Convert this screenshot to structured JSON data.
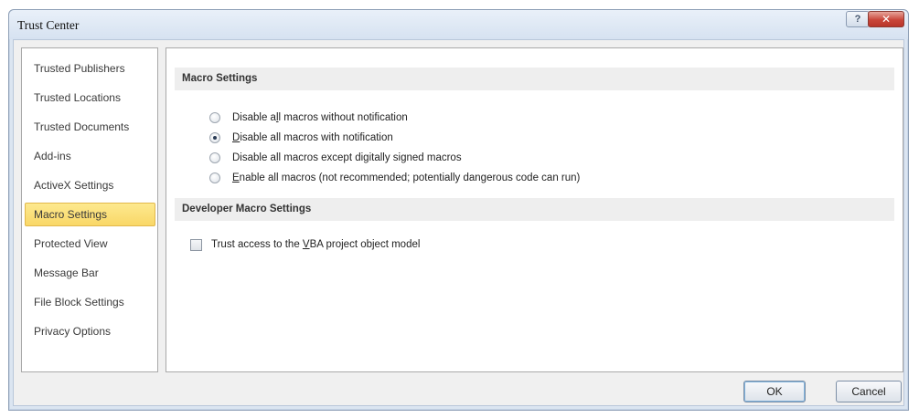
{
  "window": {
    "title": "Trust Center",
    "help_glyph": "?",
    "close_glyph": "✕"
  },
  "sidebar": {
    "items": [
      {
        "label": "Trusted Publishers",
        "selected": false
      },
      {
        "label": "Trusted Locations",
        "selected": false
      },
      {
        "label": "Trusted Documents",
        "selected": false
      },
      {
        "label": "Add-ins",
        "selected": false
      },
      {
        "label": "ActiveX Settings",
        "selected": false
      },
      {
        "label": "Macro Settings",
        "selected": true
      },
      {
        "label": "Protected View",
        "selected": false
      },
      {
        "label": "Message Bar",
        "selected": false
      },
      {
        "label": "File Block Settings",
        "selected": false
      },
      {
        "label": "Privacy Options",
        "selected": false
      }
    ]
  },
  "macro_settings": {
    "header": "Macro Settings",
    "options": [
      {
        "pre": "Disable a",
        "key": "l",
        "post": "l macros without notification",
        "checked": false
      },
      {
        "pre": "",
        "key": "D",
        "post": "isable all macros with notification",
        "checked": true
      },
      {
        "pre": "Disable all macros except di",
        "key": "g",
        "post": "itally signed macros",
        "checked": false
      },
      {
        "pre": "",
        "key": "E",
        "post": "nable all macros (not recommended; potentially dangerous code can run)",
        "checked": false
      }
    ]
  },
  "developer_macro_settings": {
    "header": "Developer Macro Settings",
    "trust_vba": {
      "pre": "Trust access to the ",
      "key": "V",
      "post": "BA project object model",
      "checked": false
    }
  },
  "footer": {
    "ok_label": "OK",
    "cancel_label": "Cancel"
  },
  "colors": {
    "selected_item": "#fde98f",
    "close_button": "#c9463a",
    "window_frame": "#dbe5f1"
  }
}
